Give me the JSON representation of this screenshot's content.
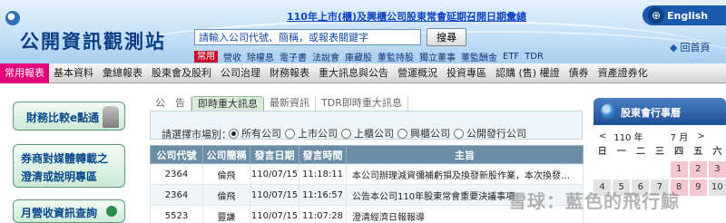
{
  "header": {
    "site_title": "公開資訊觀測站",
    "announcement": "110年上市(櫃)及興櫃公司股東常會延期召開日期彙總",
    "language_link": "English",
    "home_link": "回首頁",
    "search": {
      "placeholder": "請輸入公司代號、簡稱，或報表關鍵字",
      "value": "",
      "button": "搜尋"
    },
    "quick_label": "常用",
    "quick_links": [
      "營收",
      "除權息",
      "電子書",
      "法說會",
      "庫藏股",
      "董監持股",
      "獨立董事",
      "董監酬金",
      "ETF",
      "TDR"
    ]
  },
  "nav": {
    "items": [
      {
        "label": "常用報表",
        "active": true
      },
      {
        "label": "基本資料"
      },
      {
        "label": "彙總報表"
      },
      {
        "label": "股東會及股利"
      },
      {
        "label": "公司治理"
      },
      {
        "label": "財務報表"
      },
      {
        "label": "重大訊息與公告"
      },
      {
        "label": "營運概況"
      },
      {
        "label": "投資專區"
      },
      {
        "label": "認購 (售) 權證"
      },
      {
        "label": "債券"
      },
      {
        "label": "資產證券化"
      }
    ]
  },
  "left_banners": {
    "financial": "財務比較e點通",
    "clarify_line1": "券商對媒體轉載之",
    "clarify_line2": "澄清或說明專區",
    "monthly": "月營收資訊查詢"
  },
  "tabs": [
    "公　告",
    "即時重大訊息",
    "最新資訊",
    "TDR即時重大訊息"
  ],
  "filter": {
    "label": "請選擇市場別：",
    "options": [
      {
        "label": "所有公司",
        "checked": true
      },
      {
        "label": "上市公司",
        "checked": false
      },
      {
        "label": "上櫃公司",
        "checked": false
      },
      {
        "label": "興櫃公司",
        "checked": false
      },
      {
        "label": "公開發行公司",
        "checked": false
      }
    ]
  },
  "table": {
    "headers": [
      "公司代號",
      "公司簡稱",
      "發言日期",
      "發言時間",
      "主旨"
    ],
    "rows": [
      [
        "2364",
        "倫飛",
        "110/07/15",
        "11:18:11",
        "本公司辦理減資彌補虧損及換發新股作業，本次換發…"
      ],
      [
        "2364",
        "倫飛",
        "110/07/15",
        "11:16:57",
        "公告本公司110年股東常會重要決議事項"
      ],
      [
        "5523",
        "豐謙",
        "110/07/15",
        "11:07:28",
        "澄清經濟日報報導"
      ]
    ]
  },
  "calendar": {
    "title": "股東會行事曆",
    "prev": "<",
    "next": ">",
    "year": "110 年",
    "month": "7 月",
    "weekdays": [
      "日",
      "一",
      "二",
      "三",
      "四",
      "五",
      "六"
    ],
    "weeks": [
      [
        "",
        "",
        "",
        "",
        "1",
        "2",
        "3"
      ],
      [
        "4",
        "5",
        "6",
        "7",
        "8",
        "9",
        "10"
      ]
    ],
    "highlighted_days": [
      "1",
      "2",
      "3",
      "8",
      "9"
    ],
    "colors": {
      "highlight": "#f4c7d2",
      "normal": "#e2e2e2"
    }
  },
  "watermark": "雪球：藍色的飛行鯨",
  "colors": {
    "nav_active": "#e3007b",
    "table_header": "#6b8ea6",
    "calendar_header": "#1e4f95"
  }
}
